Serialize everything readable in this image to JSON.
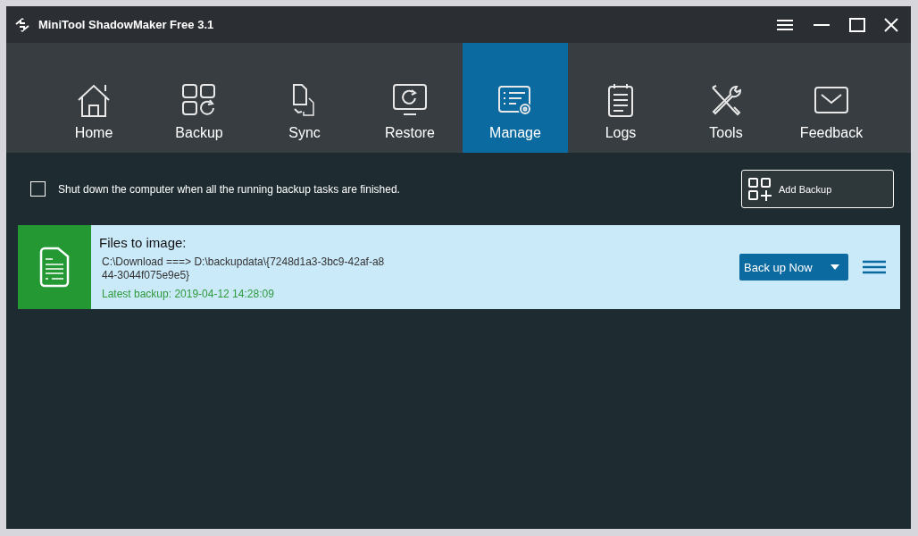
{
  "window": {
    "title": "MiniTool ShadowMaker Free 3.1"
  },
  "tabs": [
    {
      "label": "Home",
      "kind": "home",
      "selected": false
    },
    {
      "label": "Backup",
      "kind": "backup",
      "selected": false
    },
    {
      "label": "Sync",
      "kind": "sync",
      "selected": false
    },
    {
      "label": "Restore",
      "kind": "restore",
      "selected": false
    },
    {
      "label": "Manage",
      "kind": "manage",
      "selected": true
    },
    {
      "label": "Logs",
      "kind": "logs",
      "selected": false
    },
    {
      "label": "Tools",
      "kind": "tools",
      "selected": false
    },
    {
      "label": "Feedback",
      "kind": "feedback",
      "selected": false
    }
  ],
  "shutdown_option": {
    "label": "Shut down the computer when all the running backup tasks are finished.",
    "checked": false
  },
  "add_backup_button": "Add Backup",
  "tasks": [
    {
      "title": "Files to image:",
      "path": "C:\\Download ===> D:\\backupdata\\{7248d1a3-3bc9-42af-a844-3044f075e9e5}",
      "latest": "Latest backup: 2019-04-12 14:28:09",
      "action": "Back up Now"
    }
  ]
}
